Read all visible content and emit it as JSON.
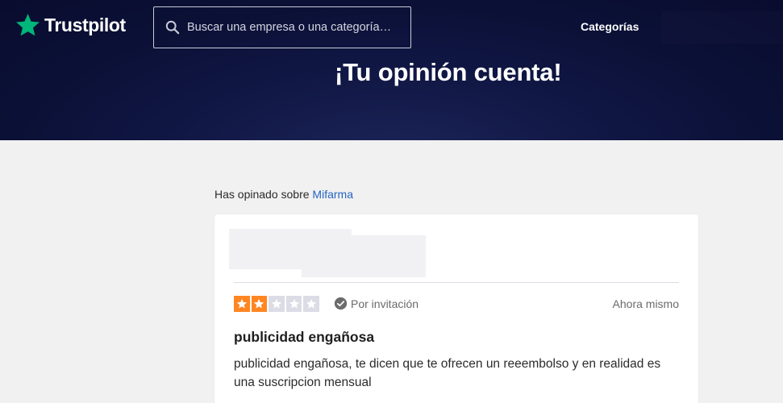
{
  "header": {
    "logo_text": "Trustpilot",
    "search": {
      "placeholder": "Buscar una empresa o una categoría…",
      "value": ""
    },
    "nav_categories": "Categorías"
  },
  "hero": {
    "title": "¡Tu opinión cuenta!"
  },
  "review_context": {
    "prefix": "Has opinado sobre ",
    "company": "Mifarma"
  },
  "review": {
    "rating": 2,
    "max_rating": 5,
    "verification": "Por invitación",
    "date": "Ahora mismo",
    "title": "publicidad engañosa",
    "body": "publicidad engañosa, te dicen que te ofrecen un reeembolso y en realidad es una suscripcion mensual"
  },
  "colors": {
    "brand_green": "#00b67a",
    "header_bg": "#0b1036",
    "rating_2_star": "#ff8622",
    "star_empty": "#dcdce6",
    "link": "#2464c2",
    "muted_text": "#6b6b6b"
  },
  "icons": {
    "logo": "star-icon",
    "search": "search-icon",
    "verification": "check-circle-icon",
    "rating": "star-icon"
  }
}
